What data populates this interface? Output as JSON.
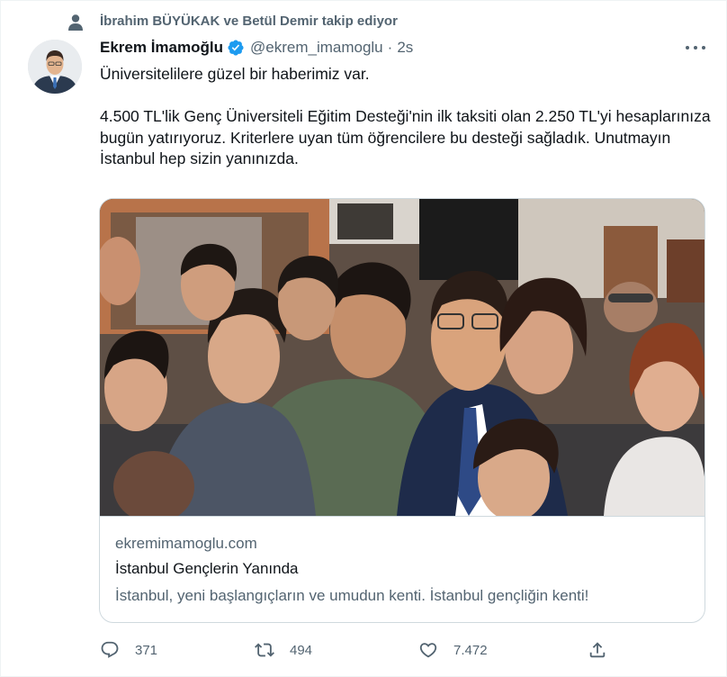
{
  "social_context": {
    "text": "İbrahim BÜYÜKAK ve Betül Demir takip ediyor",
    "icon": "person-icon"
  },
  "tweet": {
    "author_name": "Ekrem İmamoğlu",
    "handle": "@ekrem_imamoglu",
    "separator": "·",
    "time": "2s",
    "verified": true,
    "paragraphs": [
      "Üniversitelilere güzel bir haberimiz var.",
      "4.500 TL'lik Genç Üniversiteli Eğitim Desteği'nin ilk taksiti olan 2.250 TL'yi hesaplarınıza bugün yatırıyoruz. Kriterlere uyan tüm öğrencilere bu desteği sağladık. Unutmayın İstanbul hep sizin yanınızda."
    ]
  },
  "card": {
    "domain": "ekremimamoglu.com",
    "title": "İstanbul Gençlerin Yanında",
    "description": "İstanbul, yeni başlangıçların ve umudun kenti. İstanbul gençliğin kenti!"
  },
  "actions": {
    "reply_count": "371",
    "retweet_count": "494",
    "like_count": "7.472"
  },
  "colors": {
    "text_primary": "#0f1419",
    "text_secondary": "#536471",
    "verified_blue": "#1d9bf0",
    "border": "#cfd9de"
  }
}
